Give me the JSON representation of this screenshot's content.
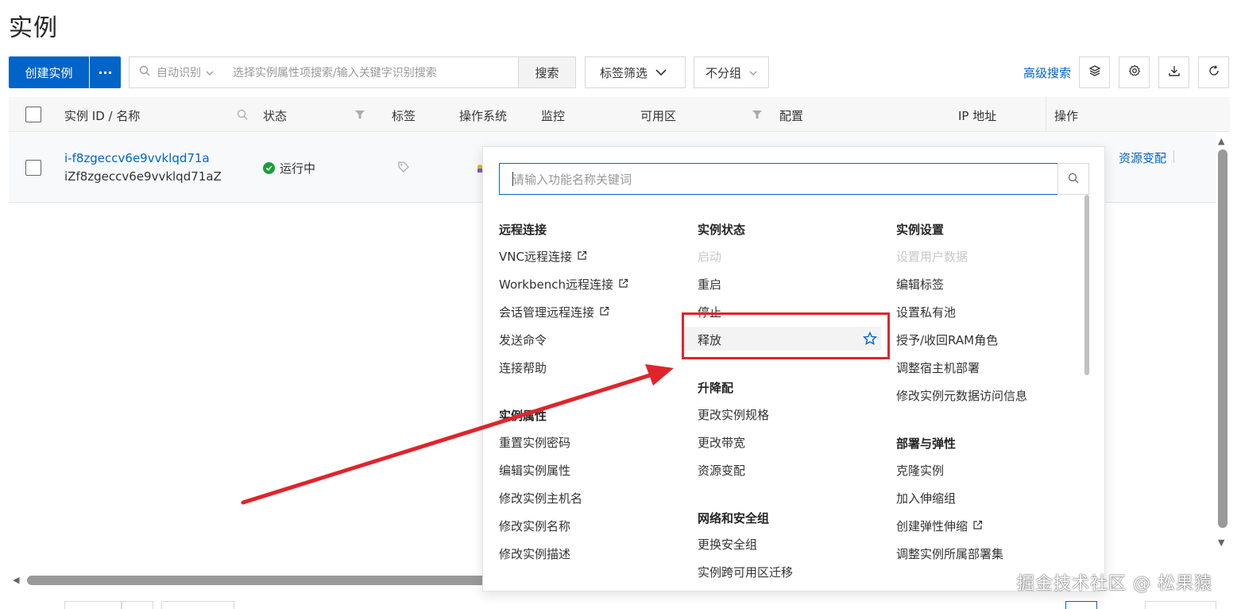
{
  "page": {
    "title": "实例"
  },
  "toolbar": {
    "create_label": "创建实例",
    "more_label": "···",
    "search_mode": "自动识别",
    "search_placeholder": "选择实例属性项搜索/输入关键字识别搜索",
    "search_button": "搜索",
    "tag_filter": "标签筛选",
    "group_select": "不分组",
    "advanced_search": "高级搜索"
  },
  "table": {
    "headers": {
      "id_name": "实例 ID / 名称",
      "status": "状态",
      "tags": "标签",
      "os": "操作系统",
      "monitor": "监控",
      "zone": "可用区",
      "config": "配置",
      "ip": "IP 地址",
      "actions": "操作"
    },
    "rows": [
      {
        "id": "i-f8zgeccv6e9vvklqd71a",
        "name": "iZf8zgeccv6e9vvklqd71aZ",
        "status": "运行中",
        "action_link": "资源变配"
      }
    ]
  },
  "menu_panel": {
    "search_placeholder": "请输入功能名称关键词",
    "groups": [
      {
        "title": "远程连接",
        "items": [
          {
            "label": "VNC远程连接",
            "external": true
          },
          {
            "label": "Workbench远程连接",
            "external": true
          },
          {
            "label": "会话管理远程连接",
            "external": true
          },
          {
            "label": "发送命令"
          },
          {
            "label": "连接帮助"
          }
        ]
      },
      {
        "title": "实例属性",
        "items": [
          {
            "label": "重置实例密码"
          },
          {
            "label": "编辑实例属性"
          },
          {
            "label": "修改实例主机名"
          },
          {
            "label": "修改实例名称"
          },
          {
            "label": "修改实例描述"
          }
        ]
      },
      {
        "title": "实例状态",
        "items": [
          {
            "label": "启动",
            "disabled": true
          },
          {
            "label": "重启"
          },
          {
            "label": "停止"
          },
          {
            "label": "释放",
            "highlighted": true
          }
        ]
      },
      {
        "title": "升降配",
        "items": [
          {
            "label": "更改实例规格"
          },
          {
            "label": "更改带宽"
          },
          {
            "label": "资源变配"
          }
        ]
      },
      {
        "title": "网络和安全组",
        "items": [
          {
            "label": "更换安全组"
          },
          {
            "label": "实例跨可用区迁移"
          }
        ]
      },
      {
        "title": "实例设置",
        "items": [
          {
            "label": "设置用户数据",
            "disabled": true
          },
          {
            "label": "编辑标签"
          },
          {
            "label": "设置私有池"
          },
          {
            "label": "授予/收回RAM角色"
          },
          {
            "label": "调整宿主机部署"
          },
          {
            "label": "修改实例元数据访问信息"
          }
        ]
      },
      {
        "title": "部署与弹性",
        "items": [
          {
            "label": "克隆实例"
          },
          {
            "label": "加入伸缩组"
          },
          {
            "label": "创建弹性伸缩",
            "external": true
          },
          {
            "label": "调整实例所属部署集"
          }
        ]
      }
    ]
  },
  "watermark": "掘金技术社区 @ 松果猿",
  "colors": {
    "primary": "#0064c8",
    "running": "#1e9c3b",
    "annotation": "#e0242b"
  }
}
